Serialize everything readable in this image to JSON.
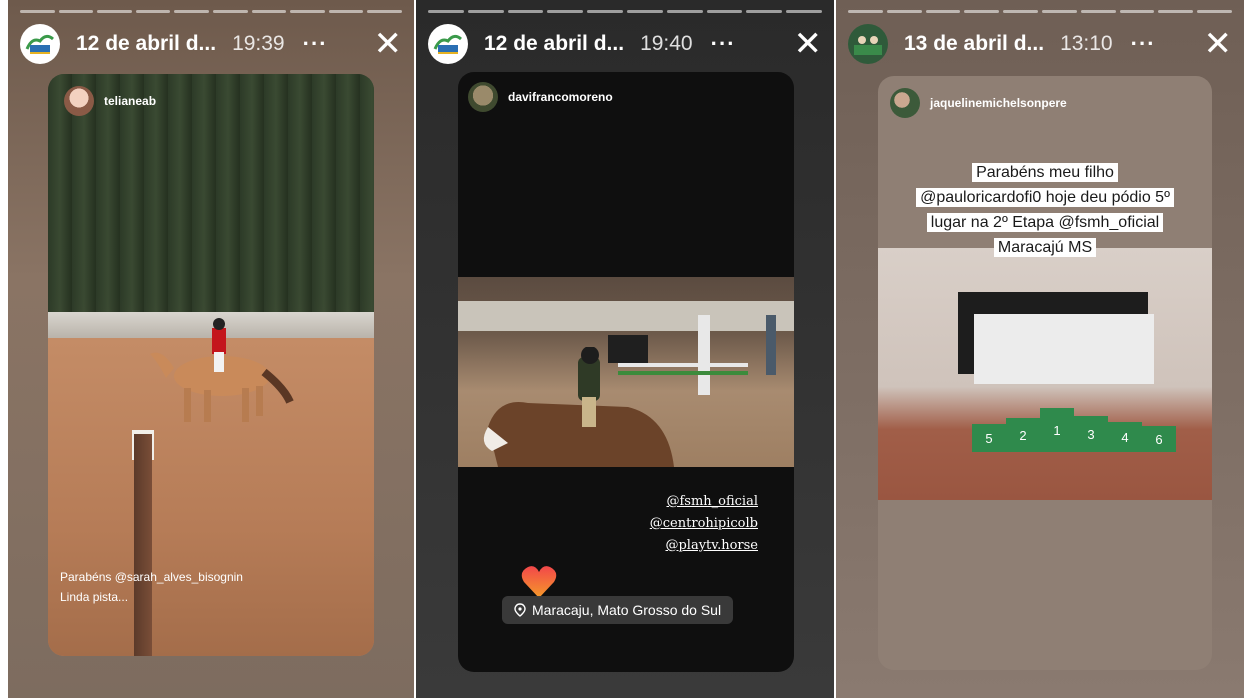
{
  "panels": [
    {
      "header": {
        "title": "12 de abril d...",
        "time": "19:39",
        "more": "···",
        "close": "✕"
      },
      "card_user": "telianeab",
      "captions": [
        "Parabéns @sarah_alves_bisognin",
        "Linda pista..."
      ]
    },
    {
      "header": {
        "title": "12 de abril d...",
        "time": "19:40",
        "more": "···",
        "close": "✕"
      },
      "card_user": "davifrancomoreno",
      "tags": [
        "@fsmh_oficial",
        "@centrohipicolb",
        "@playtv.horse"
      ],
      "location": "Maracaju, Mato Grosso do Sul"
    },
    {
      "header": {
        "title": "13 de abril d...",
        "time": "13:10",
        "more": "···",
        "close": "✕"
      },
      "card_user": "jaquelinemichelsonpere",
      "caption_lines": [
        "Parabéns meu filho",
        "@pauloricardofi0  hoje deu pódio 5º",
        "lugar na 2º Etapa @fsmh_oficial",
        "Maracajú MS"
      ],
      "podium_numbers": [
        "5",
        "2",
        "1",
        "3",
        "4",
        "6"
      ]
    }
  ],
  "colors": {
    "heart": "#e8413b",
    "podium": "#2f8a4c"
  }
}
